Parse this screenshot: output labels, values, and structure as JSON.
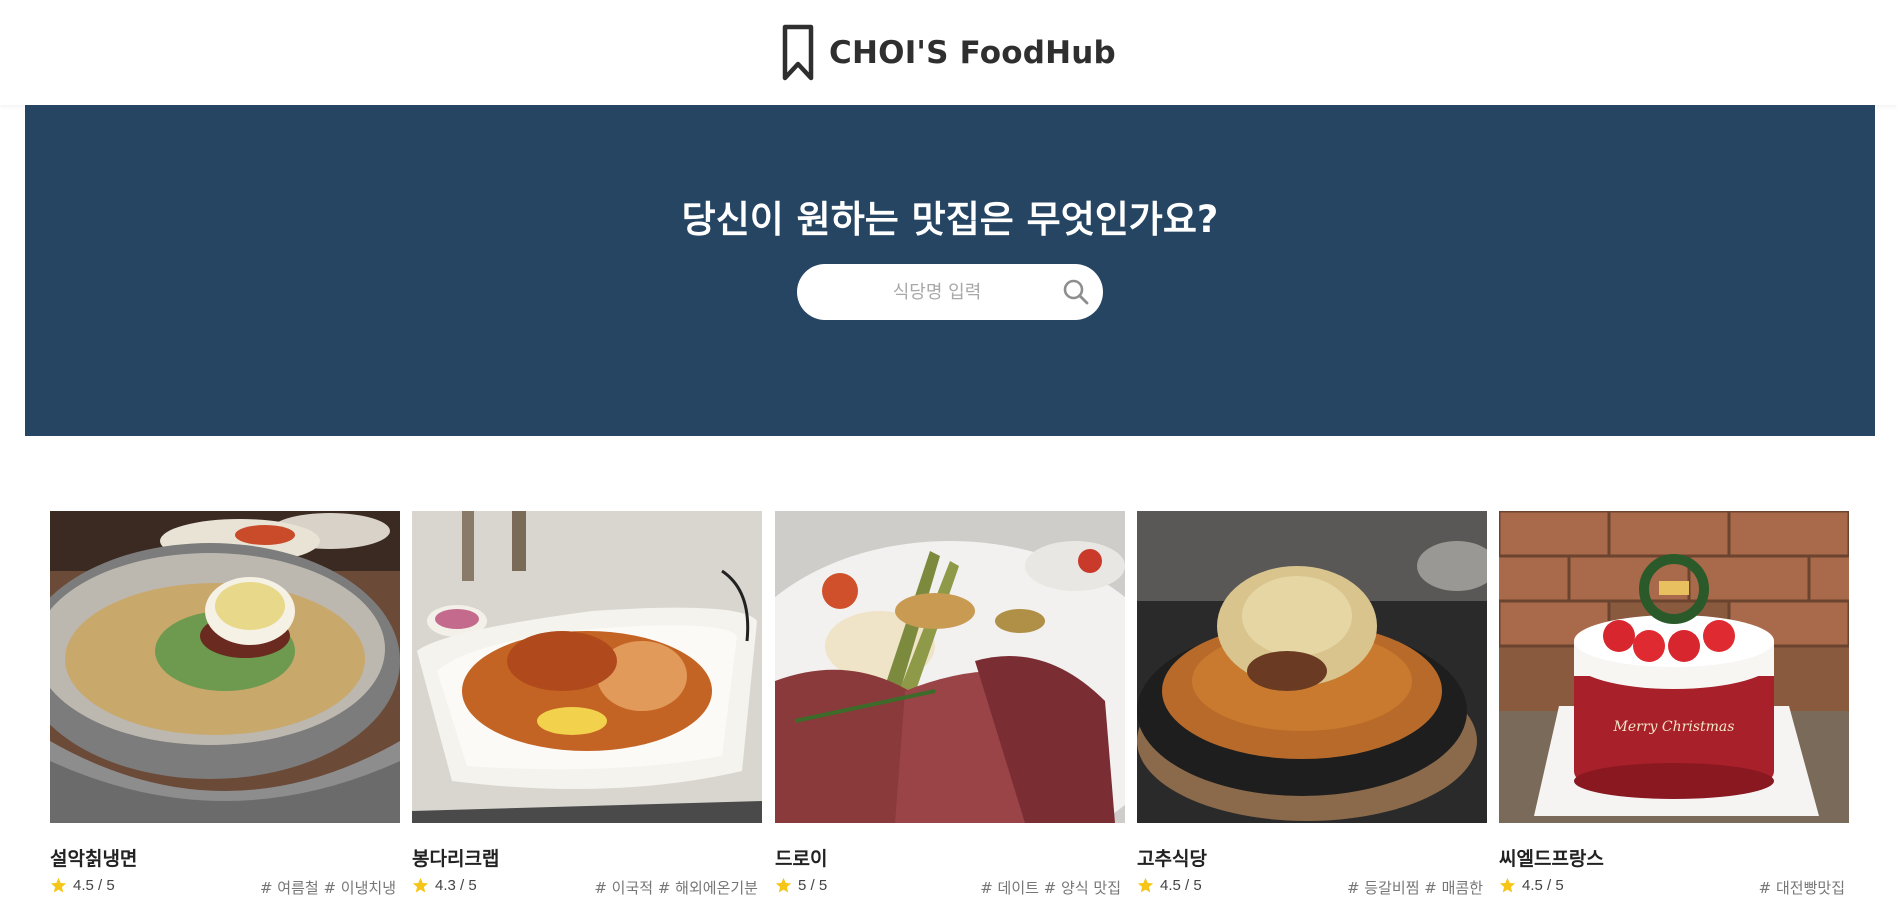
{
  "header": {
    "brand_name": "CHOI'S FoodHub",
    "brand_icon": "bookmark-icon"
  },
  "hero": {
    "title": "당신이 원하는 맛집은 무엇인가요?",
    "search": {
      "placeholder": "식당명 입력",
      "value": "",
      "icon": "search-icon"
    },
    "background_color": "#264563"
  },
  "restaurants": [
    {
      "name": "설악칡냉면",
      "rating": "4.5 / 5",
      "tags": "# 여름철 # 이냉치냉",
      "image": "naengmyeon-photo"
    },
    {
      "name": "봉다리크랩",
      "rating": "4.3 / 5",
      "tags": "# 이국적 # 해외에온기분",
      "image": "seafood-crab-photo"
    },
    {
      "name": "드로이",
      "rating": "5 / 5",
      "tags": "# 데이트 # 양식 맛집",
      "image": "steak-plate-photo"
    },
    {
      "name": "고추식당",
      "rating": "4.5 / 5",
      "tags": "# 등갈비찜 # 매콤한",
      "image": "spicy-ribs-photo"
    },
    {
      "name": "씨엘드프랑스",
      "rating": "4.5 / 5",
      "tags": "# 대전빵맛집",
      "image": "christmas-cake-photo"
    }
  ],
  "colors": {
    "star": "#f5c518",
    "hero_bg": "#264563"
  }
}
